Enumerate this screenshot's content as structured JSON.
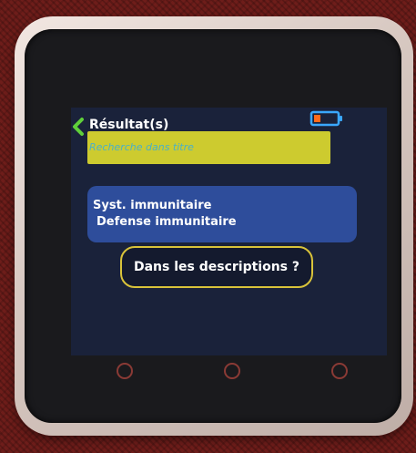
{
  "header": {
    "title": "Résultat(s)",
    "back_icon": "chevron-left-icon",
    "battery_icon": "battery-low-icon"
  },
  "search": {
    "placeholder": "Recherche dans titre"
  },
  "results": {
    "line1": "Syst. immunitaire",
    "line2": "Defense immunitaire"
  },
  "descriptions_button": {
    "label": "Dans les descriptions ?"
  },
  "colors": {
    "screen_background": "#1a223a",
    "search_bar": "#cdcb2f",
    "search_text": "#4ab0c8",
    "result_box": "#2e4d9b",
    "accent_border": "#d9c33a",
    "back_icon": "#5fcf3a",
    "battery_outline": "#3aa8ff",
    "battery_fill": "#ff6a1a"
  }
}
